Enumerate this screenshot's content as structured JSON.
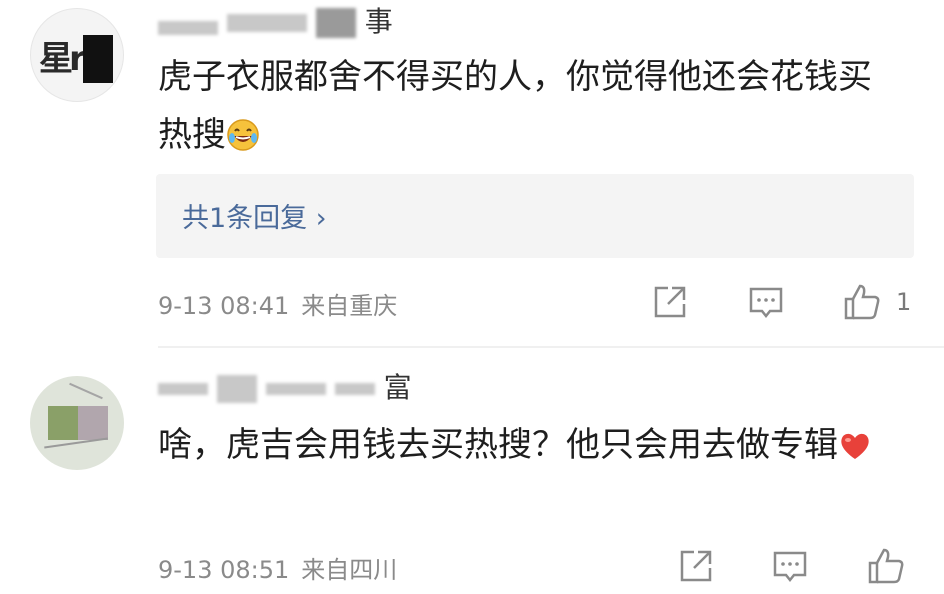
{
  "comments": [
    {
      "username": {
        "visible_end": "事"
      },
      "text": "虎子衣服都舍不得买的人，你觉得他还会花钱买热搜",
      "emoji": "laughing-tears-icon",
      "reply_link": "共1条回复 ›",
      "date": "9-13 08:41",
      "location": "来自重庆",
      "like_count": "1"
    },
    {
      "username": {
        "visible_end": "富"
      },
      "text": "啥，虎吉会用钱去买热搜？他只会用去做专辑",
      "emoji": "red-heart-icon",
      "date": "9-13 08:51",
      "location": "来自四川"
    }
  ],
  "avatar1_text": "星r",
  "colors": {
    "link": "#4a6a9a",
    "meta": "#8a8a8a",
    "reply_bg": "#f4f4f4",
    "heart": "#e8413a"
  }
}
